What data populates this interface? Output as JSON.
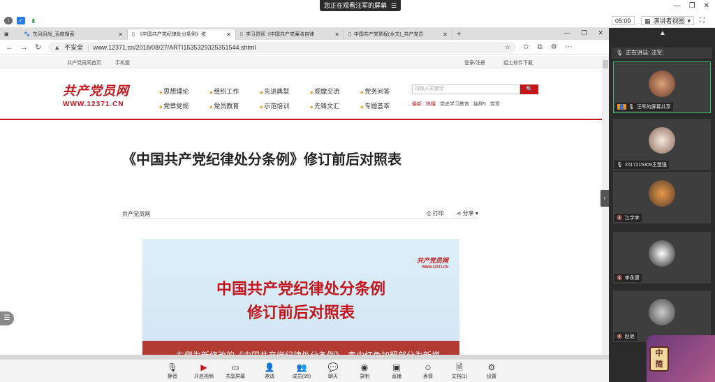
{
  "meeting": {
    "share_banner": "您正在观看汪军的屏幕",
    "timer": "05:09",
    "presenter_view": "演讲者视图",
    "speaking": "正在讲话: 汪军;",
    "participants": [
      {
        "label": "汪军的屏幕共享",
        "active": true
      },
      {
        "label": "2017215309王慧强",
        "active": false
      },
      {
        "label": "江宇李",
        "active": false
      },
      {
        "label": "李永康",
        "active": false
      },
      {
        "label": "赵旭",
        "active": false
      }
    ],
    "toolbar": [
      {
        "id": "mute",
        "label": "静音",
        "icon": "mic-icon"
      },
      {
        "id": "video",
        "label": "开启视频",
        "icon": "video-off-icon"
      },
      {
        "id": "share",
        "label": "共享屏幕",
        "icon": "share-screen-icon"
      },
      {
        "id": "invite",
        "label": "邀请",
        "icon": "invite-icon"
      },
      {
        "id": "members",
        "label": "成员(95)",
        "icon": "members-icon"
      },
      {
        "id": "chat",
        "label": "聊天",
        "icon": "chat-icon"
      },
      {
        "id": "record",
        "label": "录制",
        "icon": "record-icon"
      },
      {
        "id": "live",
        "label": "直播",
        "icon": "live-icon"
      },
      {
        "id": "emoji",
        "label": "表情",
        "icon": "emoji-icon"
      },
      {
        "id": "docs",
        "label": "文档(1)",
        "icon": "document-icon"
      },
      {
        "id": "settings",
        "label": "设置",
        "icon": "gear-icon"
      }
    ],
    "mascot_text": "中 简"
  },
  "browser": {
    "tabs": [
      {
        "title": "东风风尚_百度搜索",
        "active": false
      },
      {
        "title": "《中国共产党纪律处分条例》修",
        "active": true
      },
      {
        "title": "学习贯彻《中国共产党廉洁自律",
        "active": false
      },
      {
        "title": "中国共产党章程(全文)_共产党员",
        "active": false
      }
    ],
    "security": "不安全",
    "url": "www.12371.cn/2018/08/27/ARTI1535329325351544.shtml"
  },
  "site": {
    "top_links": [
      "共产党员网首页",
      "手机版"
    ],
    "top_right": [
      "登录/注册",
      "组工软件下载"
    ],
    "logo_cn": "共产党员网",
    "logo_url": "WWW.12371.CN",
    "nav": [
      "思想理论",
      "组织工作",
      "先进典型",
      "观摩交流",
      "党务问答",
      "党章党规",
      "党员教育",
      "示范培训",
      "先锋文汇",
      "专题荟萃"
    ],
    "search_placeholder": "请输入关键字",
    "hot": [
      "最新",
      "热搜",
      "党史学习教育",
      "抽样5",
      "党章"
    ]
  },
  "article": {
    "title": "《中国共产党纪律处分条例》修订前后对照表",
    "source": "共产党员网",
    "print": "打印",
    "share": "分享",
    "banner_logo": "共产党员网",
    "banner_logo_url": "WWW.12371.CN",
    "banner_line1": "中国共产党纪律处分条例",
    "banner_line2": "修订前后对照表",
    "banner_desc": "左侧为新修改的《中国共产党纪律处分条例》，表中红色加粗部分为新增或修改的内容，黄色带框部分为删除的内容。"
  },
  "colors": {
    "brand_red": "#c4161c",
    "active_green": "#35c26a"
  }
}
